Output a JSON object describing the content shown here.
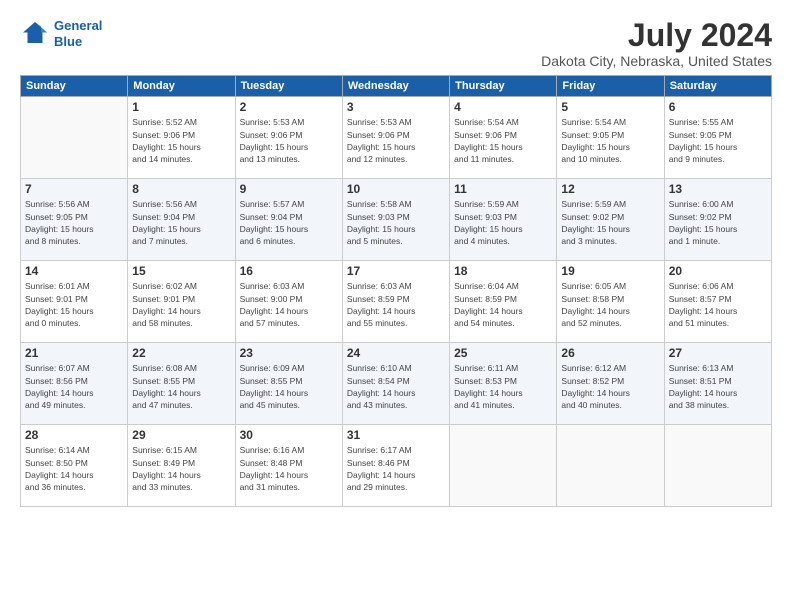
{
  "header": {
    "logo_line1": "General",
    "logo_line2": "Blue",
    "title": "July 2024",
    "subtitle": "Dakota City, Nebraska, United States"
  },
  "weekdays": [
    "Sunday",
    "Monday",
    "Tuesday",
    "Wednesday",
    "Thursday",
    "Friday",
    "Saturday"
  ],
  "weeks": [
    [
      {
        "day": "",
        "info": ""
      },
      {
        "day": "1",
        "info": "Sunrise: 5:52 AM\nSunset: 9:06 PM\nDaylight: 15 hours\nand 14 minutes."
      },
      {
        "day": "2",
        "info": "Sunrise: 5:53 AM\nSunset: 9:06 PM\nDaylight: 15 hours\nand 13 minutes."
      },
      {
        "day": "3",
        "info": "Sunrise: 5:53 AM\nSunset: 9:06 PM\nDaylight: 15 hours\nand 12 minutes."
      },
      {
        "day": "4",
        "info": "Sunrise: 5:54 AM\nSunset: 9:06 PM\nDaylight: 15 hours\nand 11 minutes."
      },
      {
        "day": "5",
        "info": "Sunrise: 5:54 AM\nSunset: 9:05 PM\nDaylight: 15 hours\nand 10 minutes."
      },
      {
        "day": "6",
        "info": "Sunrise: 5:55 AM\nSunset: 9:05 PM\nDaylight: 15 hours\nand 9 minutes."
      }
    ],
    [
      {
        "day": "7",
        "info": "Sunrise: 5:56 AM\nSunset: 9:05 PM\nDaylight: 15 hours\nand 8 minutes."
      },
      {
        "day": "8",
        "info": "Sunrise: 5:56 AM\nSunset: 9:04 PM\nDaylight: 15 hours\nand 7 minutes."
      },
      {
        "day": "9",
        "info": "Sunrise: 5:57 AM\nSunset: 9:04 PM\nDaylight: 15 hours\nand 6 minutes."
      },
      {
        "day": "10",
        "info": "Sunrise: 5:58 AM\nSunset: 9:03 PM\nDaylight: 15 hours\nand 5 minutes."
      },
      {
        "day": "11",
        "info": "Sunrise: 5:59 AM\nSunset: 9:03 PM\nDaylight: 15 hours\nand 4 minutes."
      },
      {
        "day": "12",
        "info": "Sunrise: 5:59 AM\nSunset: 9:02 PM\nDaylight: 15 hours\nand 3 minutes."
      },
      {
        "day": "13",
        "info": "Sunrise: 6:00 AM\nSunset: 9:02 PM\nDaylight: 15 hours\nand 1 minute."
      }
    ],
    [
      {
        "day": "14",
        "info": "Sunrise: 6:01 AM\nSunset: 9:01 PM\nDaylight: 15 hours\nand 0 minutes."
      },
      {
        "day": "15",
        "info": "Sunrise: 6:02 AM\nSunset: 9:01 PM\nDaylight: 14 hours\nand 58 minutes."
      },
      {
        "day": "16",
        "info": "Sunrise: 6:03 AM\nSunset: 9:00 PM\nDaylight: 14 hours\nand 57 minutes."
      },
      {
        "day": "17",
        "info": "Sunrise: 6:03 AM\nSunset: 8:59 PM\nDaylight: 14 hours\nand 55 minutes."
      },
      {
        "day": "18",
        "info": "Sunrise: 6:04 AM\nSunset: 8:59 PM\nDaylight: 14 hours\nand 54 minutes."
      },
      {
        "day": "19",
        "info": "Sunrise: 6:05 AM\nSunset: 8:58 PM\nDaylight: 14 hours\nand 52 minutes."
      },
      {
        "day": "20",
        "info": "Sunrise: 6:06 AM\nSunset: 8:57 PM\nDaylight: 14 hours\nand 51 minutes."
      }
    ],
    [
      {
        "day": "21",
        "info": "Sunrise: 6:07 AM\nSunset: 8:56 PM\nDaylight: 14 hours\nand 49 minutes."
      },
      {
        "day": "22",
        "info": "Sunrise: 6:08 AM\nSunset: 8:55 PM\nDaylight: 14 hours\nand 47 minutes."
      },
      {
        "day": "23",
        "info": "Sunrise: 6:09 AM\nSunset: 8:55 PM\nDaylight: 14 hours\nand 45 minutes."
      },
      {
        "day": "24",
        "info": "Sunrise: 6:10 AM\nSunset: 8:54 PM\nDaylight: 14 hours\nand 43 minutes."
      },
      {
        "day": "25",
        "info": "Sunrise: 6:11 AM\nSunset: 8:53 PM\nDaylight: 14 hours\nand 41 minutes."
      },
      {
        "day": "26",
        "info": "Sunrise: 6:12 AM\nSunset: 8:52 PM\nDaylight: 14 hours\nand 40 minutes."
      },
      {
        "day": "27",
        "info": "Sunrise: 6:13 AM\nSunset: 8:51 PM\nDaylight: 14 hours\nand 38 minutes."
      }
    ],
    [
      {
        "day": "28",
        "info": "Sunrise: 6:14 AM\nSunset: 8:50 PM\nDaylight: 14 hours\nand 36 minutes."
      },
      {
        "day": "29",
        "info": "Sunrise: 6:15 AM\nSunset: 8:49 PM\nDaylight: 14 hours\nand 33 minutes."
      },
      {
        "day": "30",
        "info": "Sunrise: 6:16 AM\nSunset: 8:48 PM\nDaylight: 14 hours\nand 31 minutes."
      },
      {
        "day": "31",
        "info": "Sunrise: 6:17 AM\nSunset: 8:46 PM\nDaylight: 14 hours\nand 29 minutes."
      },
      {
        "day": "",
        "info": ""
      },
      {
        "day": "",
        "info": ""
      },
      {
        "day": "",
        "info": ""
      }
    ]
  ]
}
